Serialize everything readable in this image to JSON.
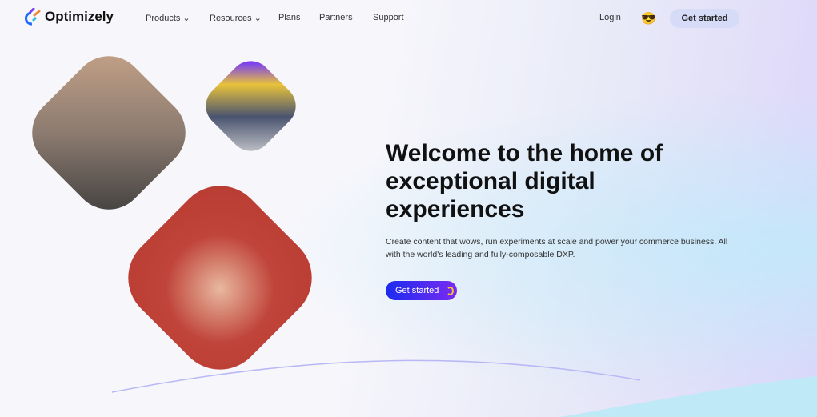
{
  "brand": {
    "name": "Optimizely"
  },
  "nav": {
    "items": [
      {
        "label": "Products",
        "dropdown": true
      },
      {
        "label": "Resources",
        "dropdown": true
      },
      {
        "label": "Plans"
      },
      {
        "label": "Partners"
      },
      {
        "label": "Support"
      }
    ],
    "login": "Login",
    "avatar_icon": "sunglasses-face-icon",
    "get_started": "Get started"
  },
  "hero": {
    "title": "Welcome to the home of exceptional digital experiences",
    "subtitle": "Create content that wows, run experiments at scale and power your commerce business. All with the world's leading and fully-composable DXP.",
    "cta": "Get started"
  },
  "colors": {
    "cta_start": "#1c2bf0",
    "cta_end": "#7a2bf0",
    "accent": "#f7c13a"
  }
}
